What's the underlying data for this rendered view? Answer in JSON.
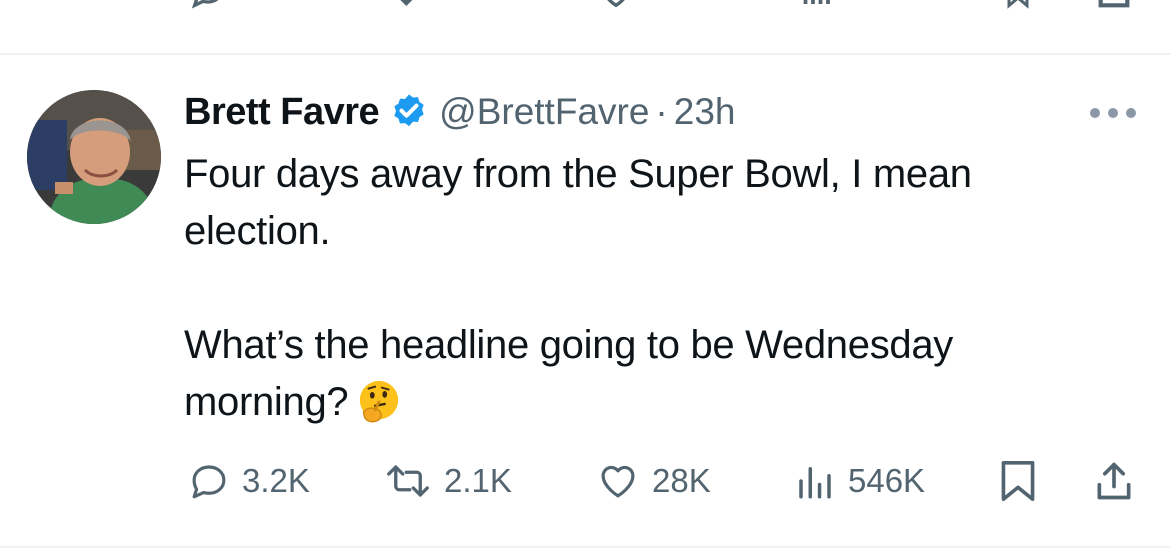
{
  "tweet": {
    "author_name": "Brett Favre",
    "handle": "@BrettFavre",
    "separator": "·",
    "time": "23h",
    "line1": "Four days away from the Super Bowl, I mean election.",
    "line2": "What’s the headline going to be Wednesday morning?"
  },
  "actions": {
    "replies": "3.2K",
    "reposts": "2.1K",
    "likes": "28K",
    "views": "546K"
  },
  "icons": {
    "verified": "verified-badge-icon",
    "more": "more-dots-icon",
    "reply": "reply-icon",
    "repost": "repost-icon",
    "like": "heart-icon",
    "views": "views-icon",
    "bookmark": "bookmark-icon",
    "share": "share-icon",
    "emoji": "thinking-face-emoji"
  },
  "colors": {
    "text": "#0f1419",
    "secondary": "#536471",
    "verified": "#1d9bf0",
    "divider": "#eff3f4"
  }
}
